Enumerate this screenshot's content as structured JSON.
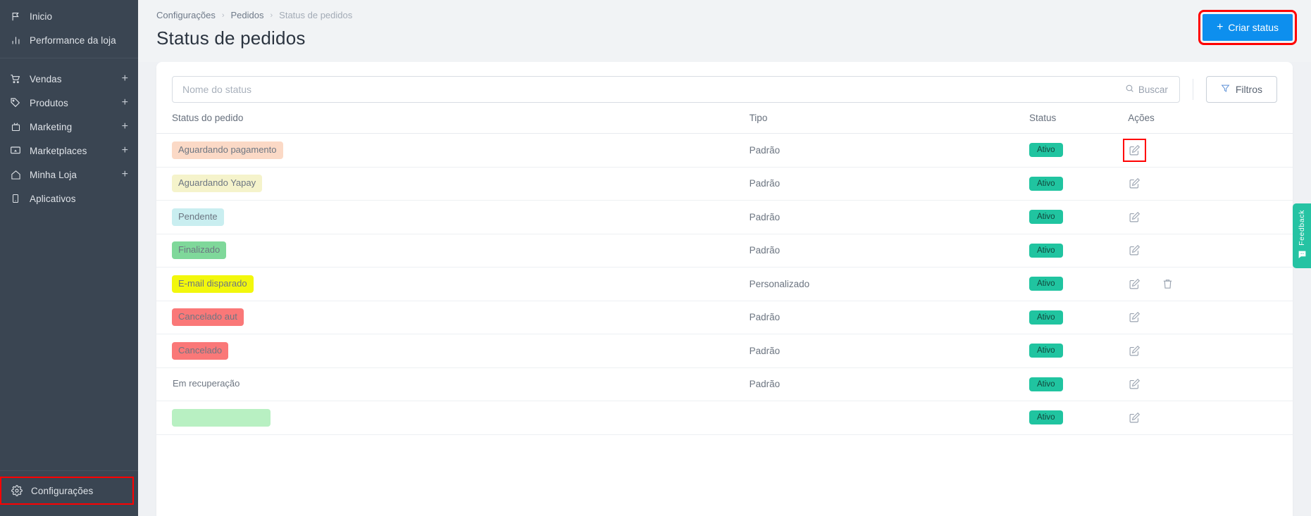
{
  "sidebar": {
    "groups": [
      {
        "items": [
          {
            "label": "Inicio",
            "icon": "flag-icon",
            "expandable": false
          },
          {
            "label": "Performance da loja",
            "icon": "bar-chart-icon",
            "expandable": false
          }
        ]
      },
      {
        "items": [
          {
            "label": "Vendas",
            "icon": "cart-icon",
            "expandable": true,
            "plus": "+"
          },
          {
            "label": "Produtos",
            "icon": "tag-icon",
            "expandable": true,
            "plus": "+"
          },
          {
            "label": "Marketing",
            "icon": "megaphone-icon",
            "expandable": true,
            "plus": "+"
          },
          {
            "label": "Marketplaces",
            "icon": "monitor-icon",
            "expandable": true,
            "plus": "+"
          },
          {
            "label": "Minha Loja",
            "icon": "home-icon",
            "expandable": true,
            "plus": "+"
          },
          {
            "label": "Aplicativos",
            "icon": "mobile-icon",
            "expandable": false
          }
        ]
      }
    ],
    "footer": {
      "label": "Configurações",
      "icon": "gear-icon",
      "highlighted": true
    }
  },
  "header": {
    "breadcrumb": [
      "Configurações",
      "Pedidos",
      "Status de pedidos"
    ],
    "breadcrumb_separator": "›",
    "title": "Status de pedidos",
    "create_button": {
      "label": "Criar status",
      "plus": "+",
      "color": "#0d8fee",
      "highlighted": true
    }
  },
  "toolbar": {
    "search_placeholder": "Nome do status",
    "search_value": "",
    "search_button": "Buscar",
    "filters_button": "Filtros"
  },
  "table": {
    "columns": [
      "Status do pedido",
      "Tipo",
      "Status",
      "Ações"
    ],
    "rows": [
      {
        "name": "Aguardando pagamento",
        "bg": "#fbd9c6",
        "tipo": "Padrão",
        "status": "Ativo",
        "edit": true,
        "delete": false,
        "edit_highlighted": true
      },
      {
        "name": "Aguardando Yapay",
        "bg": "#f5f3cb",
        "tipo": "Padrão",
        "status": "Ativo",
        "edit": true,
        "delete": false,
        "edit_highlighted": false
      },
      {
        "name": "Pendente",
        "bg": "#c9eef0",
        "tipo": "Padrão",
        "status": "Ativo",
        "edit": true,
        "delete": false,
        "edit_highlighted": false
      },
      {
        "name": "Finalizado",
        "bg": "#7fd89a",
        "tipo": "Padrão",
        "status": "Ativo",
        "edit": true,
        "delete": false,
        "edit_highlighted": false
      },
      {
        "name": "E-mail disparado",
        "bg": "#f2f70c",
        "tipo": "Personalizado",
        "status": "Ativo",
        "edit": true,
        "delete": true,
        "edit_highlighted": false
      },
      {
        "name": "Cancelado aut",
        "bg": "#fa7878",
        "tipo": "Padrão",
        "status": "Ativo",
        "edit": true,
        "delete": false,
        "edit_highlighted": false
      },
      {
        "name": "Cancelado",
        "bg": "#fa7878",
        "tipo": "Padrão",
        "status": "Ativo",
        "edit": true,
        "delete": false,
        "edit_highlighted": false
      },
      {
        "name": "Em recuperação",
        "bg": "transparent",
        "tipo": "Padrão",
        "status": "Ativo",
        "edit": true,
        "delete": false,
        "edit_highlighted": false
      },
      {
        "name": "",
        "bg": "#b8f0c2",
        "tipo": "",
        "status": "Ativo",
        "edit": true,
        "delete": false,
        "edit_highlighted": false
      }
    ]
  },
  "feedback": {
    "label": "Feedback",
    "icon": "smiley-chat-icon",
    "color": "#25c3a3"
  }
}
